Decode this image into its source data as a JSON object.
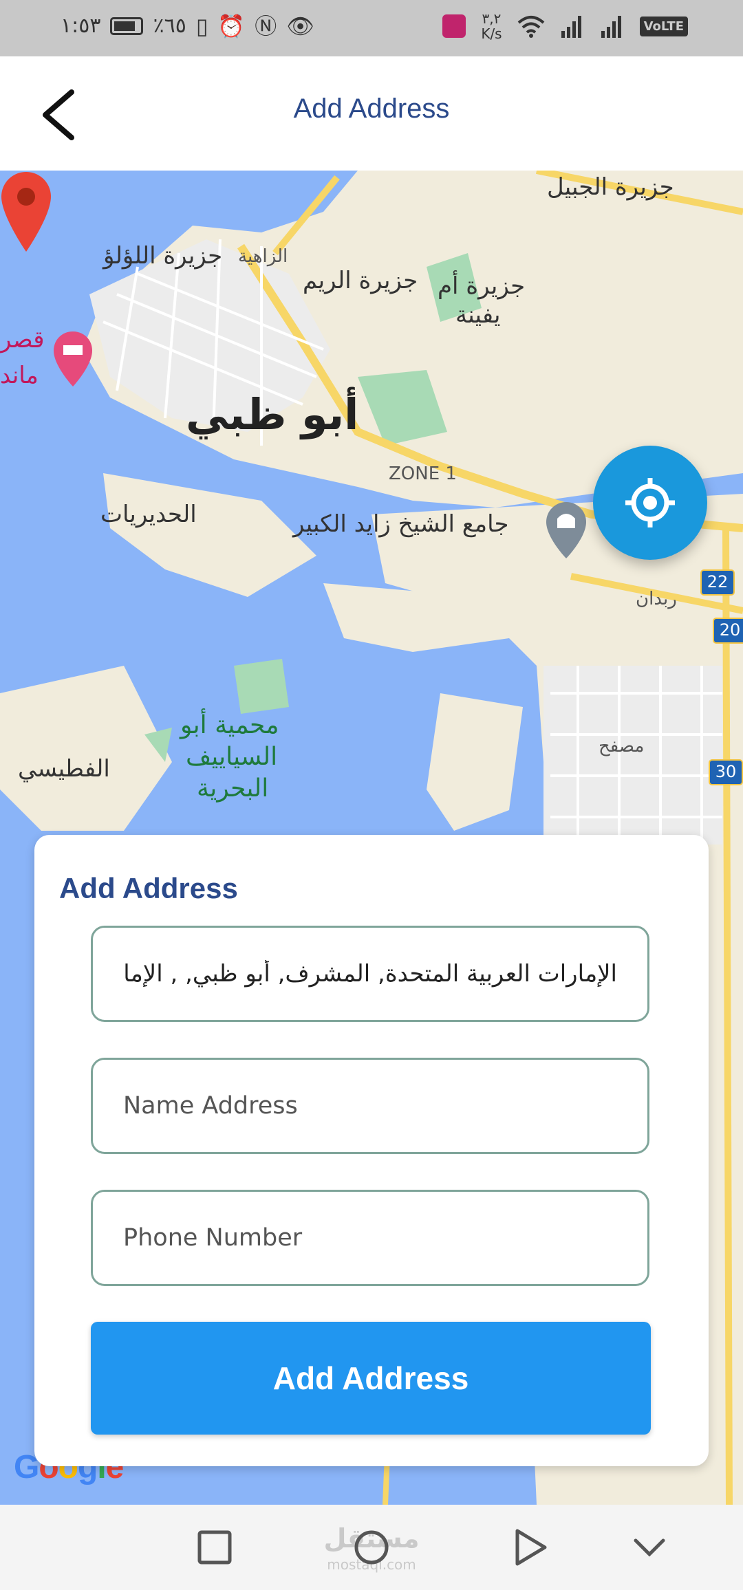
{
  "status_bar": {
    "time": "١:٥٣",
    "battery_percent": "٪٦٥",
    "network_speed_value": "٣,٢",
    "network_speed_unit": "K/s",
    "volte": "VoLTE",
    "icons": [
      "battery-icon",
      "vibrate-icon",
      "alarm-icon",
      "nfc-icon",
      "eye-icon",
      "app-notification-icon",
      "wifi-icon",
      "signal-icon",
      "signal-icon-2"
    ]
  },
  "app_bar": {
    "title": "Add Address",
    "back_icon": "chevron-left-icon"
  },
  "map": {
    "labels": {
      "jubail": "جزيرة الجبيل",
      "lulu": "جزيرة اللؤلؤ",
      "zahiya": "الزاهية",
      "reem": "جزيرة الريم",
      "umm_yifenah_1": "جزيرة أم",
      "umm_yifenah_2": "يفينة",
      "qasr_1": "قصر",
      "qasr_2": "ماند",
      "abu_dhabi": "أبو ظبي",
      "zone1": "ZONE 1",
      "hudayriyat": "الحديريات",
      "mosque": "جامع الشيخ زايد الكبير",
      "rabdan": "ربدان",
      "reserve_1": "محمية أبو",
      "reserve_2": "السياييف",
      "reserve_3": "البحرية",
      "mussafah": "مصفح",
      "futaisi": "الفطيسي"
    },
    "road_badges": [
      "22",
      "20",
      "30"
    ],
    "google_logo": "Google",
    "locate_icon": "crosshair-icon",
    "pin_icon": "location-pin-icon"
  },
  "form": {
    "title": "Add Address",
    "address_value": "الإمارات العربية المتحدة, المشرف, أبو ظبي, , الإمارات العربية المتحدة",
    "name_placeholder": "Name Address",
    "phone_placeholder": "Phone Number",
    "submit_label": "Add Address"
  },
  "nav_bar": {
    "icons": [
      "square-icon",
      "circle-icon",
      "triangle-icon",
      "chevron-down-icon"
    ],
    "watermark": "مستقل",
    "watermark_sub": "mostaql.com"
  },
  "colors": {
    "primary": "#2196f0",
    "title": "#2b4a8b",
    "fab": "#1a98dc",
    "field_border": "#7fa59a",
    "map_water": "#8ab4f8"
  }
}
